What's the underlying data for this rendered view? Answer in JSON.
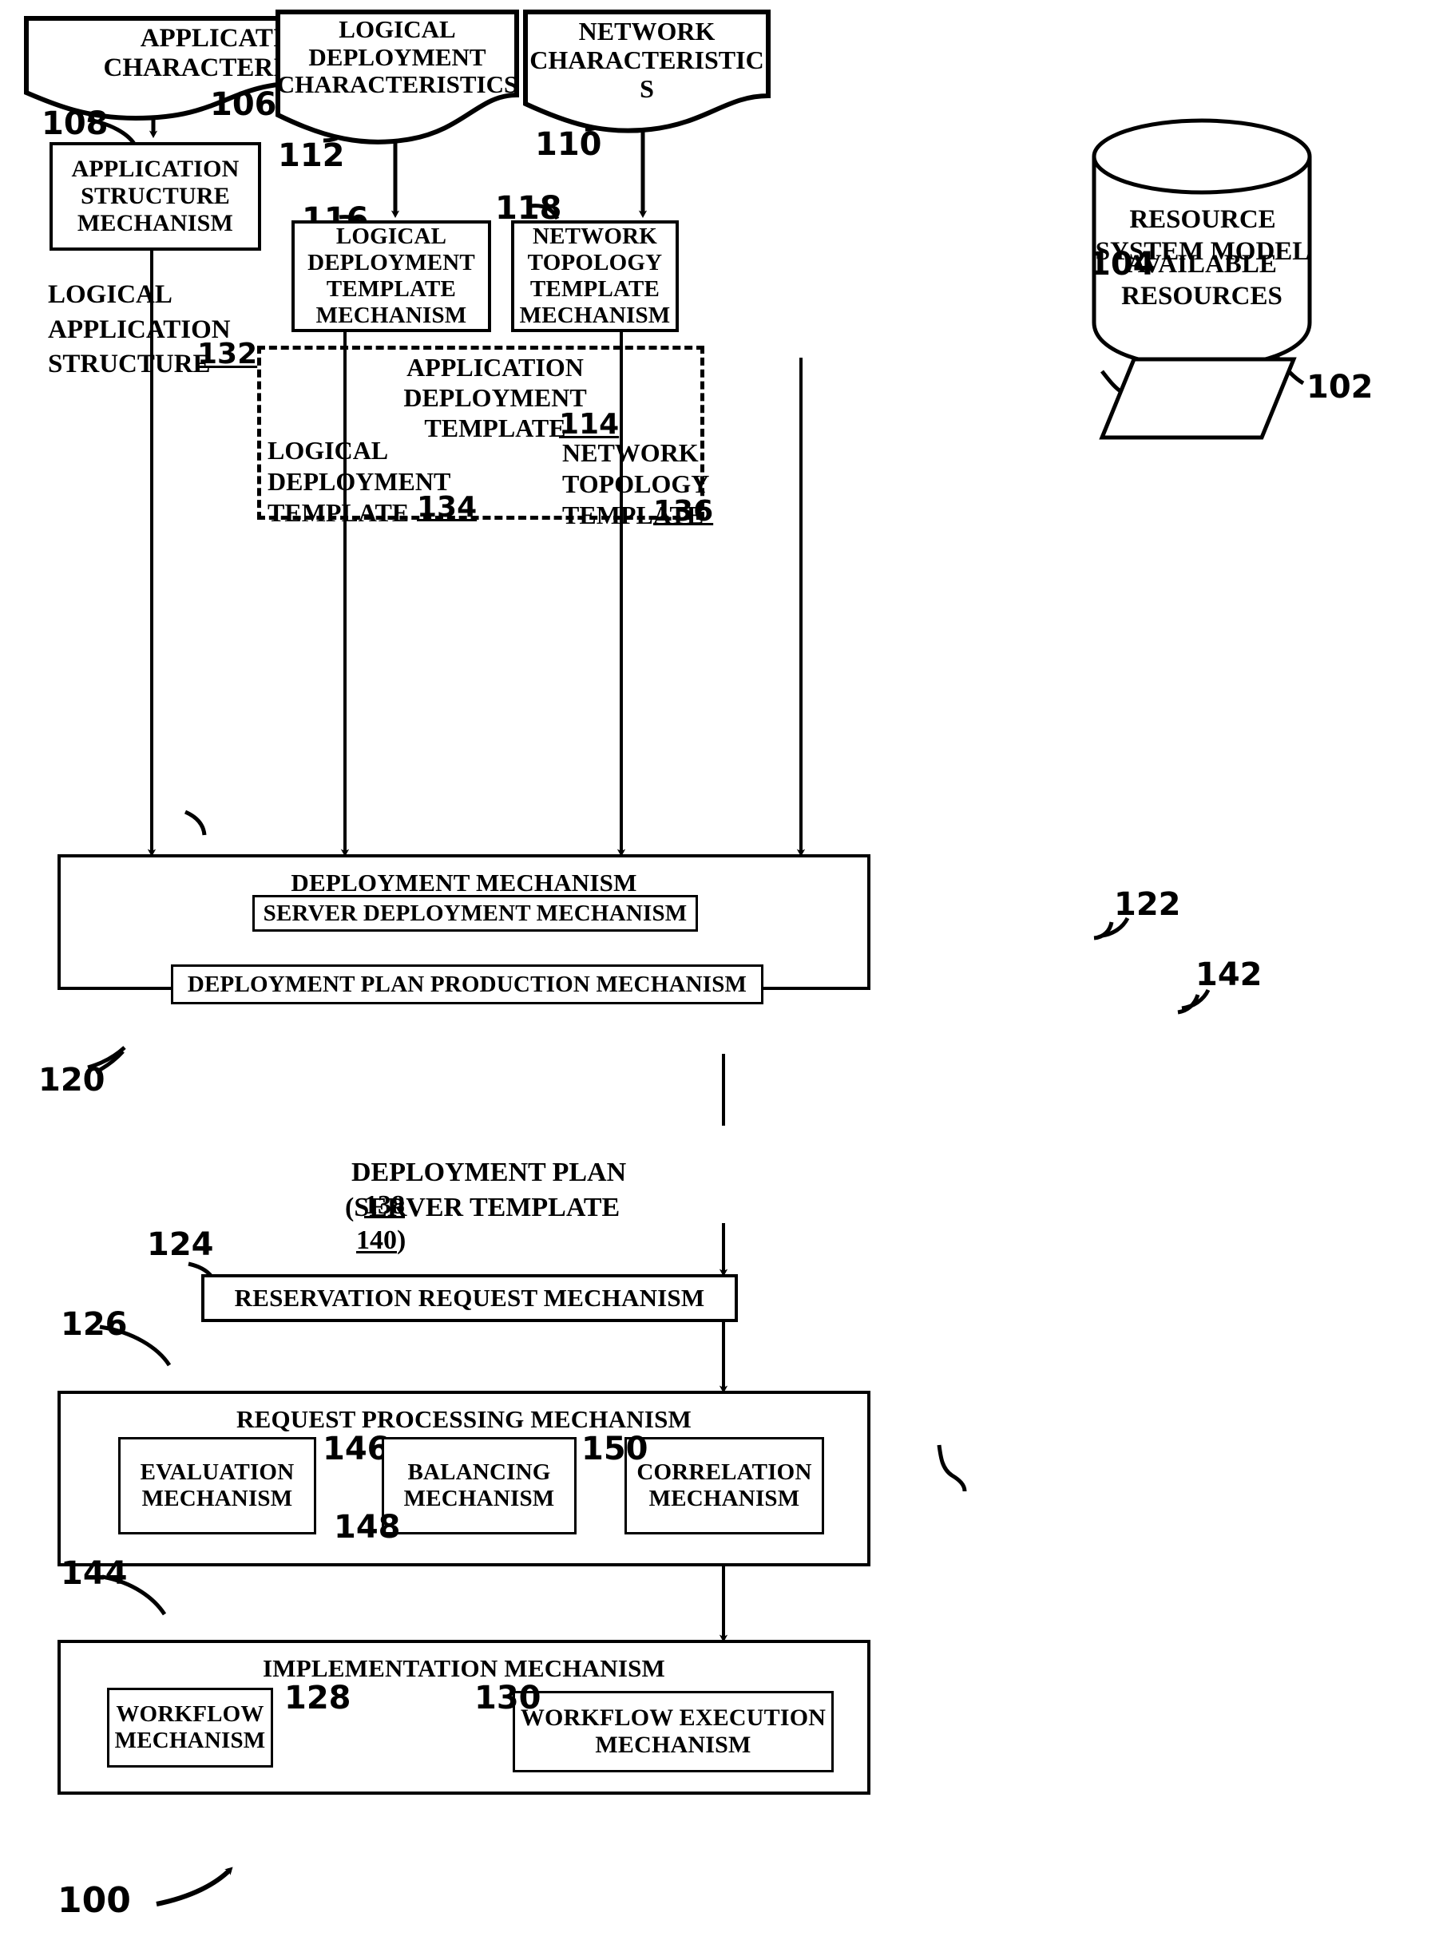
{
  "figure": {
    "number": "100",
    "type": "patent-block-diagram"
  },
  "inputs": [
    {
      "id": "app_char",
      "title": "APPLICATION\nCHARACTERISTICS",
      "ref": "106"
    },
    {
      "id": "logdep_char",
      "title": "LOGICAL\nDEPLOYMENT\nCHARACTERISTICS",
      "ref": "112"
    },
    {
      "id": "net_char",
      "title": "NETWORK\nCHARACTERISTIC S",
      "ref": "110"
    }
  ],
  "mechanisms": {
    "application_structure": {
      "title": "APPLICATION\nSTRUCTURE\nMECHANISM",
      "ref": "108"
    },
    "logical_deployment_template": {
      "title": "LOGICAL\nDEPLOYMENT\nTEMPLATE\nMECHANISM",
      "ref": "116"
    },
    "network_topology_template": {
      "title": "NETWORK\nTOPOLOGY\nTEMPLATE\nMECHANISM",
      "ref": "118"
    },
    "deployment": {
      "title": "DEPLOYMENT MECHANISM",
      "ref": "120"
    },
    "server_deployment": {
      "title": "SERVER DEPLOYMENT MECHANISM",
      "ref": "122"
    },
    "deployment_plan_production": {
      "title": "DEPLOYMENT PLAN PRODUCTION MECHANISM",
      "ref": "142"
    },
    "reservation_request": {
      "title": "RESERVATION REQUEST MECHANISM",
      "ref": "124"
    },
    "request_processing": {
      "title": "REQUEST PROCESSING MECHANISM",
      "ref": "126"
    },
    "evaluation": {
      "title": "EVALUATION\nMECHANISM",
      "ref": "146"
    },
    "balancing": {
      "title": "BALANCING\nMECHANISM",
      "ref": "148"
    },
    "correlation": {
      "title": "CORRELATION\nMECHANISM",
      "ref": "150"
    },
    "implementation": {
      "title": "IMPLEMENTATION MECHANISM",
      "ref": "144"
    },
    "workflow": {
      "title": "WORKFLOW\nMECHANISM",
      "ref": "128"
    },
    "workflow_execution": {
      "title": "WORKFLOW EXECUTION\nMECHANISM",
      "ref": "130"
    }
  },
  "datastore": {
    "resource_system_model": {
      "title": "RESOURCE\nSYSTEM MODEL",
      "ref": "102"
    },
    "available_resources": {
      "title": "AVAILABLE\nRESOURCES",
      "ref": "104"
    }
  },
  "artifacts": {
    "logical_application_structure": {
      "title": "LOGICAL\nAPPLICATION\nSTRUCTURE",
      "ref": "132"
    },
    "application_deployment_template": {
      "title": "APPLICATION\nDEPLOYMENT\nTEMPLATE",
      "ref": "114"
    },
    "logical_deployment_template": {
      "title": "LOGICAL\nDEPLOYMENT\nTEMPLATE",
      "ref": "134"
    },
    "network_topology_template": {
      "title": "NETWORK\nTOPOLOGY\nTEMPLATE",
      "ref": "136"
    },
    "deployment_plan": {
      "title": "DEPLOYMENT PLAN",
      "ref": "138"
    },
    "server_template": {
      "title": "(SERVER TEMPLATE",
      "ref": "140",
      "suffix": ")"
    }
  }
}
